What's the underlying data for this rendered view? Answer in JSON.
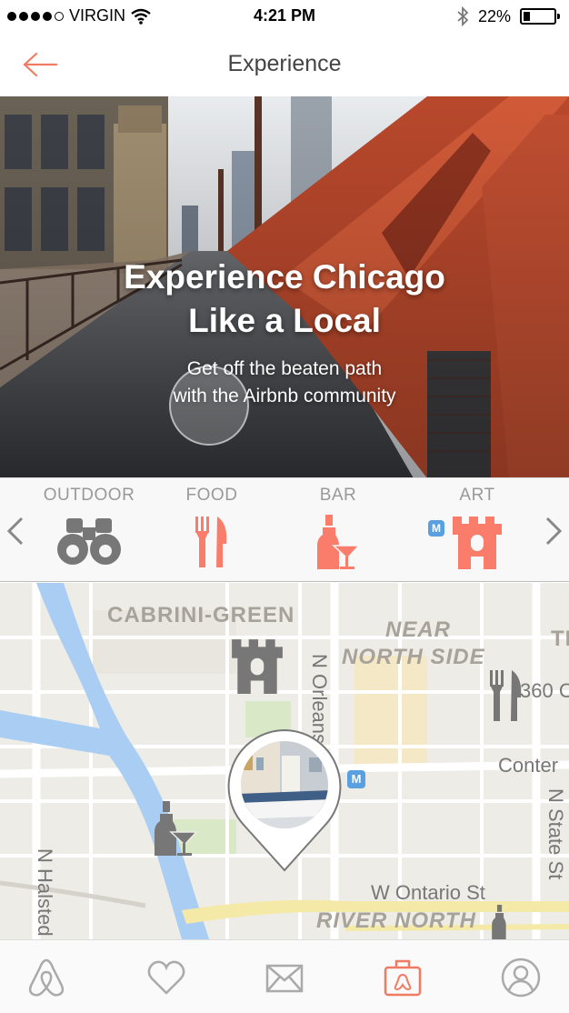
{
  "status_bar": {
    "carrier": "VIRGIN",
    "time": "4:21 PM",
    "battery": "22%",
    "battery_level": 0.22
  },
  "nav": {
    "title": "Experience",
    "back_icon": "arrow-left-icon",
    "accent_color": "#f07b62"
  },
  "hero": {
    "title_line1": "Experience Chicago",
    "title_line2": "Like a Local",
    "subtitle_line1": "Get off the beaten path",
    "subtitle_line2": "with the  Airbnb community"
  },
  "categories": {
    "items": [
      {
        "label": "OUTDOOR",
        "icon": "binoculars-icon",
        "color": "#777777"
      },
      {
        "label": "FOOD",
        "icon": "fork-knife-icon",
        "color": "#fa7d6c"
      },
      {
        "label": "BAR",
        "icon": "bottle-glass-icon",
        "color": "#fa7d6c"
      },
      {
        "label": "ART",
        "icon": "castle-icon",
        "color": "#fa7d6c"
      }
    ],
    "prev_icon": "chevron-left-icon",
    "next_icon": "chevron-right-icon"
  },
  "map": {
    "neighborhoods": {
      "cabrini": "CABRINI-GREEN",
      "near_line1": "NEAR",
      "near_line2": "NORTH SIDE",
      "river_north": "RIVER NORTH",
      "edge_t": "TI"
    },
    "streets": {
      "orleans": "N Orleans",
      "halsted": "N Halsted",
      "state": "N State St",
      "ontario": "W Ontario St",
      "conter": "Conter",
      "three_sixty": "360 C"
    },
    "metro_label": "M",
    "markers": [
      "castle-icon",
      "fork-knife-icon",
      "bottle-glass-icon",
      "listing-photo-pin"
    ]
  },
  "tab_bar": {
    "tabs": [
      {
        "icon": "airbnb-logo-icon",
        "active": false
      },
      {
        "icon": "heart-icon",
        "active": false
      },
      {
        "icon": "envelope-icon",
        "active": false
      },
      {
        "icon": "suitcase-icon",
        "active": true
      },
      {
        "icon": "profile-icon",
        "active": false
      }
    ],
    "active_color": "#f07b62",
    "inactive_color": "#aaaaaa"
  }
}
